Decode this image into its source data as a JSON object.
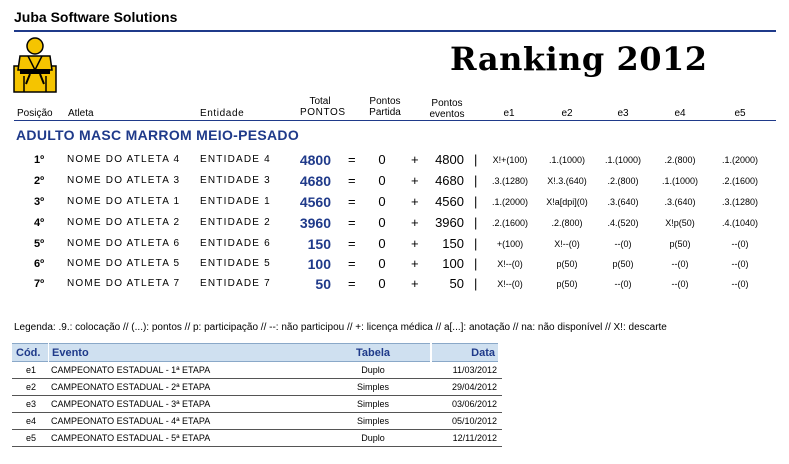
{
  "company": "Juba Software Solutions",
  "title": "Ranking 2012",
  "headers": {
    "posicao": "Posição",
    "atleta": "Atleta",
    "entidade": "Entidade",
    "total_line1": "Total",
    "total_line2": "PONTOS",
    "partida_line1": "Pontos",
    "partida_line2": "Partida",
    "eventos_line1": "Pontos",
    "eventos_line2": "eventos",
    "e1": "e1",
    "e2": "e2",
    "e3": "e3",
    "e4": "e4",
    "e5": "e5"
  },
  "category": "ADULTO MASC  MARROM  MEIO-PESADO",
  "rows": [
    {
      "pos": "1º",
      "athlete": "NOME DO ATLETA 4",
      "entity": "ENTIDADE 4",
      "total": "4800",
      "eq": "=",
      "partida": "0",
      "plus": "+",
      "eventos": "4800",
      "bar": "|",
      "e1": "X!+(100)",
      "e2": ".1.(1000)",
      "e3": ".1.(1000)",
      "e4": ".2.(800)",
      "e5": ".1.(2000)"
    },
    {
      "pos": "2º",
      "athlete": "NOME DO ATLETA 3",
      "entity": "ENTIDADE 3",
      "total": "4680",
      "eq": "=",
      "partida": "0",
      "plus": "+",
      "eventos": "4680",
      "bar": "|",
      "e1": ".3.(1280)",
      "e2": "X!.3.(640)",
      "e3": ".2.(800)",
      "e4": ".1.(1000)",
      "e5": ".2.(1600)"
    },
    {
      "pos": "3º",
      "athlete": "NOME DO ATLETA 1",
      "entity": "ENTIDADE 1",
      "total": "4560",
      "eq": "=",
      "partida": "0",
      "plus": "+",
      "eventos": "4560",
      "bar": "|",
      "e1": ".1.(2000)",
      "e2": "X!a[dpi](0)",
      "e3": ".3.(640)",
      "e4": ".3.(640)",
      "e5": ".3.(1280)"
    },
    {
      "pos": "4º",
      "athlete": "NOME DO ATLETA 2",
      "entity": "ENTIDADE 2",
      "total": "3960",
      "eq": "=",
      "partida": "0",
      "plus": "+",
      "eventos": "3960",
      "bar": "|",
      "e1": ".2.(1600)",
      "e2": ".2.(800)",
      "e3": ".4.(520)",
      "e4": "X!p(50)",
      "e5": ".4.(1040)"
    },
    {
      "pos": "5º",
      "athlete": "NOME DO ATLETA 6",
      "entity": "ENTIDADE 6",
      "total": "150",
      "eq": "=",
      "partida": "0",
      "plus": "+",
      "eventos": "150",
      "bar": "|",
      "e1": "+(100)",
      "e2": "X!--(0)",
      "e3": "--(0)",
      "e4": "p(50)",
      "e5": "--(0)"
    },
    {
      "pos": "6º",
      "athlete": "NOME DO ATLETA 5",
      "entity": "ENTIDADE 5",
      "total": "100",
      "eq": "=",
      "partida": "0",
      "plus": "+",
      "eventos": "100",
      "bar": "|",
      "e1": "X!--(0)",
      "e2": "p(50)",
      "e3": "p(50)",
      "e4": "--(0)",
      "e5": "--(0)"
    },
    {
      "pos": "7º",
      "athlete": "NOME DO ATLETA 7",
      "entity": "ENTIDADE 7",
      "total": "50",
      "eq": "=",
      "partida": "0",
      "plus": "+",
      "eventos": "50",
      "bar": "|",
      "e1": "X!--(0)",
      "e2": "p(50)",
      "e3": "--(0)",
      "e4": "--(0)",
      "e5": "--(0)"
    }
  ],
  "legend": "Legenda:   .9.: colocação // (...): pontos // p: participação // --: não participou // +: licença médica // a[...]: anotação // na: não disponível // X!: descarte",
  "events_table": {
    "headers": {
      "cod": "Cód.",
      "evento": "Evento",
      "tabela": "Tabela",
      "data": "Data"
    },
    "rows": [
      {
        "cod": "e1",
        "evento": "CAMPEONATO ESTADUAL - 1ª ETAPA",
        "tabela": "Duplo",
        "data": "11/03/2012"
      },
      {
        "cod": "e2",
        "evento": "CAMPEONATO ESTADUAL - 2ª ETAPA",
        "tabela": "Simples",
        "data": "29/04/2012"
      },
      {
        "cod": "e3",
        "evento": "CAMPEONATO ESTADUAL - 3ª ETAPA",
        "tabela": "Simples",
        "data": "03/06/2012"
      },
      {
        "cod": "e4",
        "evento": "CAMPEONATO ESTADUAL - 4ª ETAPA",
        "tabela": "Simples",
        "data": "05/10/2012"
      },
      {
        "cod": "e5",
        "evento": "CAMPEONATO ESTADUAL - 5ª ETAPA",
        "tabela": "Duplo",
        "data": "12/11/2012"
      }
    ]
  },
  "colors": {
    "accent": "#1f3a8a",
    "logo_yellow": "#f5c400",
    "table_header_bg": "#cfe0f0"
  },
  "icons": {
    "logo": "judoka-logo-icon"
  }
}
